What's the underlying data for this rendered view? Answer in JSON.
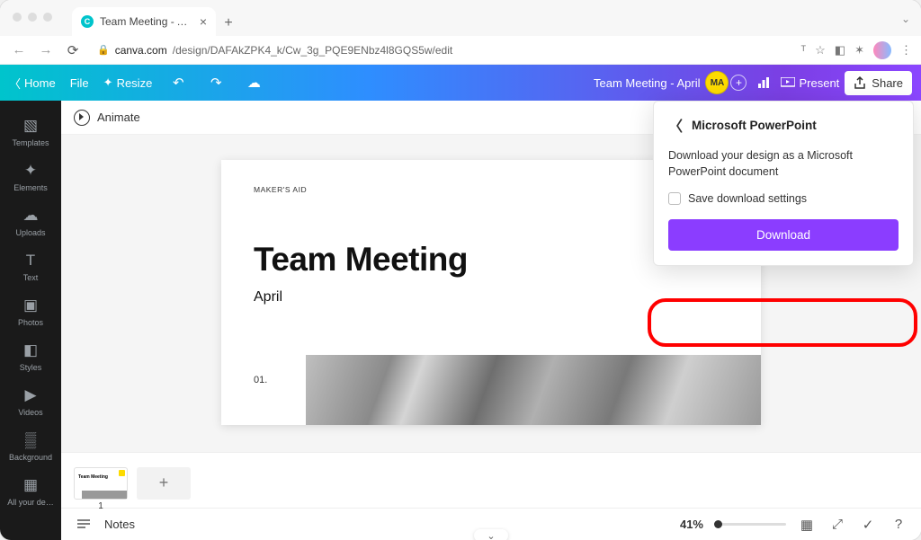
{
  "browser": {
    "tab_title": "Team Meeting - April - Presen",
    "url_domain": "canva.com",
    "url_path": "/design/DAFAkZPK4_k/Cw_3g_PQE9ENbz4l8GQS5w/edit"
  },
  "canva_bar": {
    "home": "Home",
    "file": "File",
    "resize": "Resize",
    "doc_title": "Team Meeting - April",
    "avatar_initials": "MA",
    "present": "Present",
    "share": "Share"
  },
  "left_rail": [
    {
      "label": "Templates",
      "icon": "▧"
    },
    {
      "label": "Elements",
      "icon": "✦"
    },
    {
      "label": "Uploads",
      "icon": "☁"
    },
    {
      "label": "Text",
      "icon": "T"
    },
    {
      "label": "Photos",
      "icon": "▣"
    },
    {
      "label": "Styles",
      "icon": "◧"
    },
    {
      "label": "Videos",
      "icon": "▶"
    },
    {
      "label": "Background",
      "icon": "▒"
    },
    {
      "label": "All your de…",
      "icon": "▦"
    }
  ],
  "animate_label": "Animate",
  "slide": {
    "brand": "MAKER'S AID",
    "title": "Team Meeting",
    "subtitle": "April",
    "number": "01."
  },
  "thumbs": {
    "page_label": "1",
    "thumb_title": "Team Meeting"
  },
  "bottom": {
    "notes": "Notes",
    "zoom": "41%"
  },
  "download_panel": {
    "title": "Microsoft PowerPoint",
    "description": "Download your design as a Microsoft PowerPoint document",
    "checkbox_label": "Save download settings",
    "button": "Download"
  }
}
